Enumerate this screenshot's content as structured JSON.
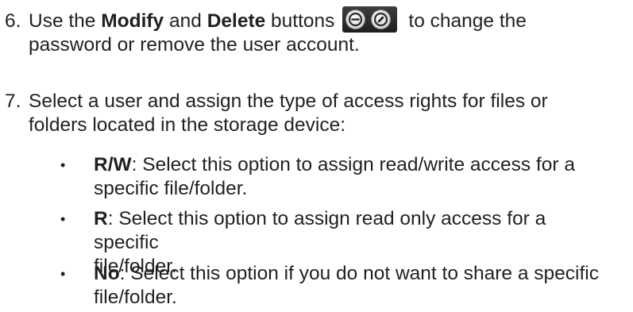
{
  "steps": [
    {
      "number": "6.",
      "text_before": "Use the ",
      "bold1": "Modify",
      "text_mid": " and ",
      "bold2": "Delete",
      "text_after_bold": " buttons",
      "text_end_line1": "to change the",
      "line2": "password or remove the user account.",
      "icons": [
        "delete-icon",
        "modify-icon"
      ]
    },
    {
      "number": "7.",
      "line1": "Select a user and assign the type of access rights for files or",
      "line2": "folders located in the storage device:"
    }
  ],
  "bullets": [
    {
      "symbol": "•",
      "label": "R/W",
      "line1": ": Select this option to assign read/write access for a",
      "line2": "specific file/folder."
    },
    {
      "symbol": "•",
      "label": "R",
      "line1": ": Select this option to assign read only access for a specific",
      "line2": "file/folder."
    },
    {
      "symbol": "•",
      "label": "No",
      "line1": ": Select this option if you do not want to share a specific",
      "line2": "file/folder."
    }
  ]
}
